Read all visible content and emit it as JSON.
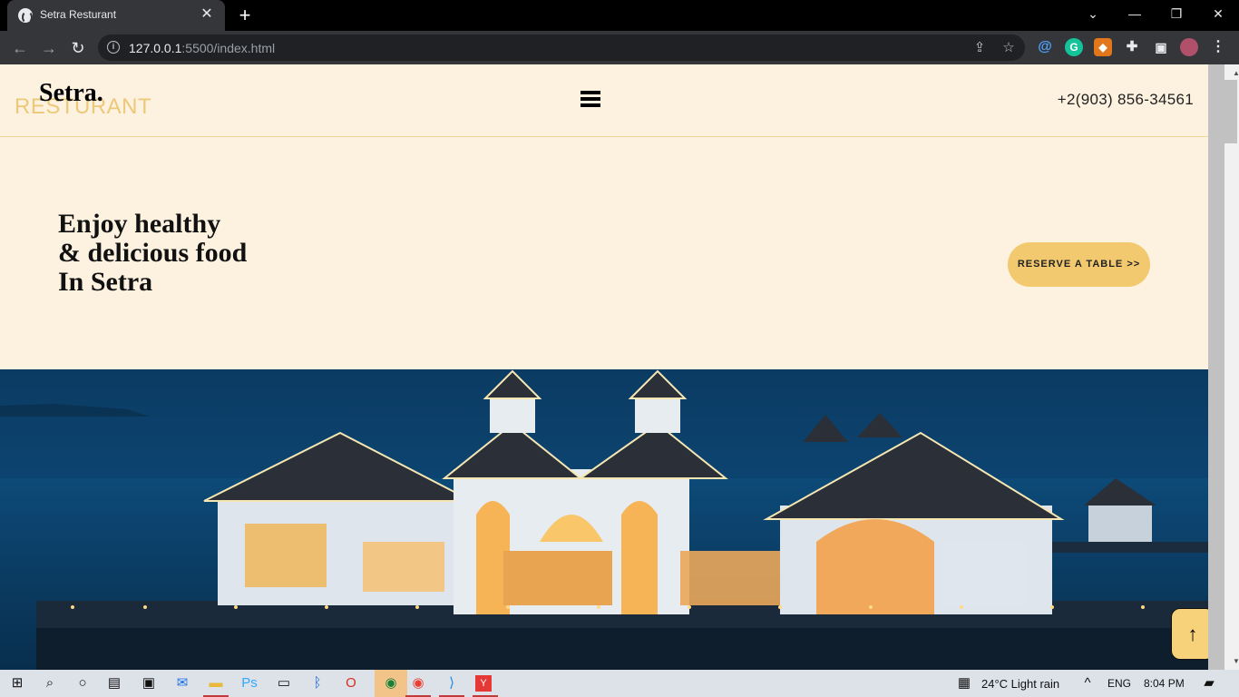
{
  "browser": {
    "tab_title": "Setra Resturant",
    "url_host": "127.0.0.1",
    "url_path": ":5500/index.html"
  },
  "header": {
    "logo": "Setra.",
    "logo_sub": "RESTURANT",
    "phone": "+2(903) 856-34561"
  },
  "hero": {
    "title_lines": [
      "Enjoy healthy",
      "& delicious food",
      "In Setra"
    ],
    "reserve_label": "RESERVE  A  TABLE  >>"
  },
  "back_to_top": "↑",
  "taskbar": {
    "weather": "24°C  Light rain",
    "lang": "ENG",
    "time": "8:04 PM"
  },
  "colors": {
    "page_bg": "#fdf2e0",
    "accent": "#f2c96e",
    "logo_sub": "#ecc97a"
  }
}
